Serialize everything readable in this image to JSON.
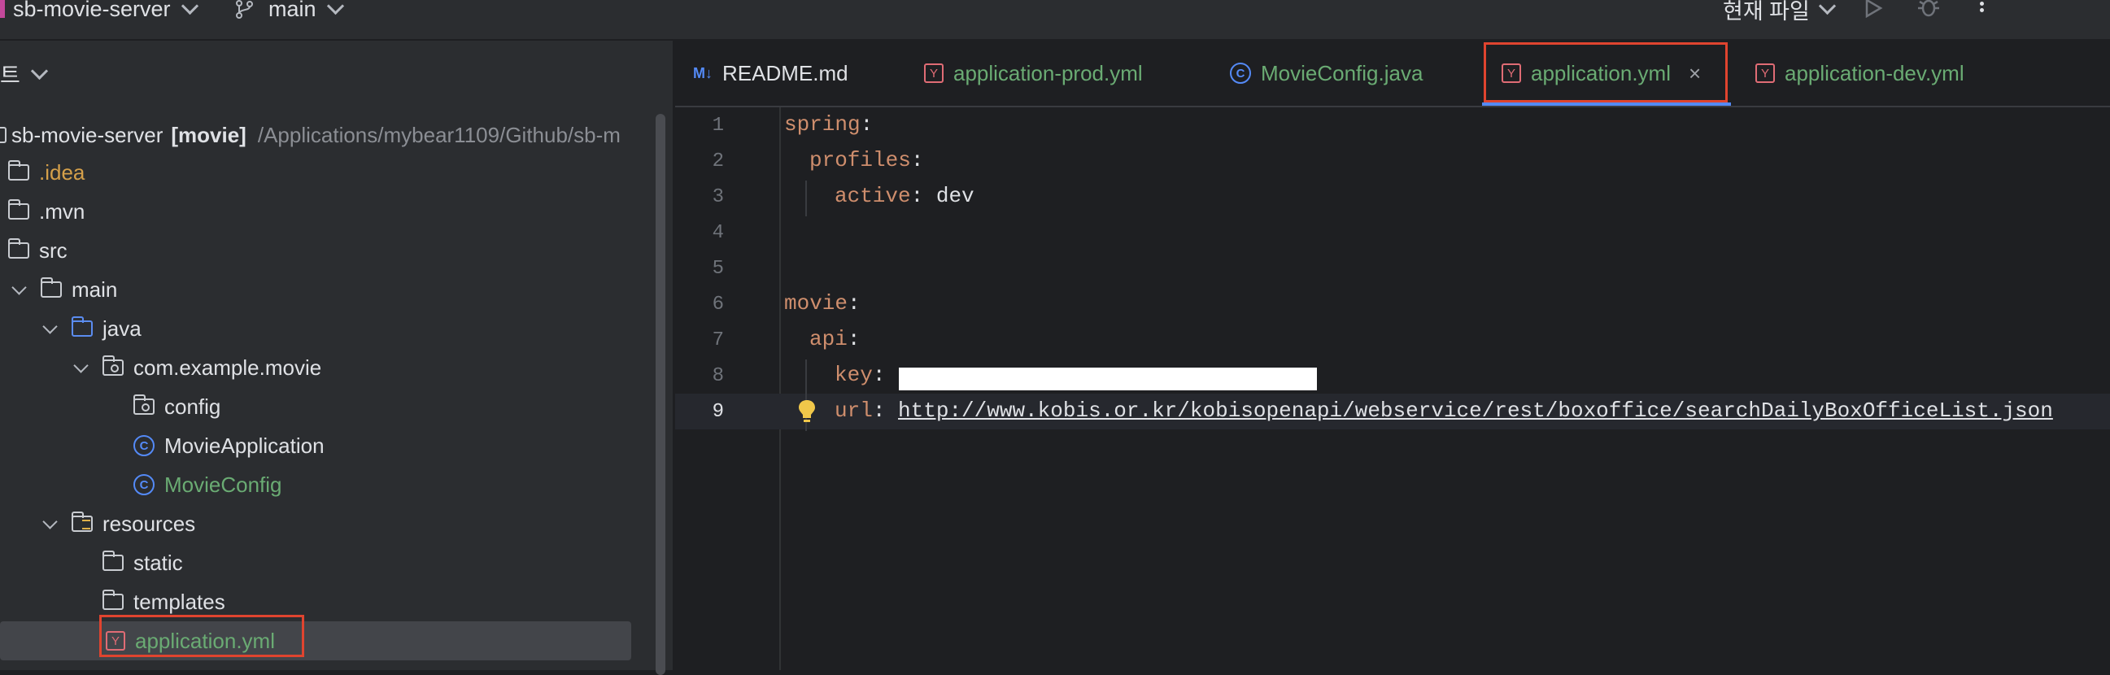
{
  "titlebar": {
    "project": "sb-movie-server",
    "branch": "main",
    "run_config": "현재 파일"
  },
  "project_panel": {
    "title": "트",
    "root": {
      "name": "sb-movie-server",
      "module": "[movie]",
      "path": "/Applications/mybear1109/Github/sb-m"
    },
    "items": [
      {
        "label": ".idea"
      },
      {
        "label": ".mvn"
      },
      {
        "label": "src"
      },
      {
        "label": "main"
      },
      {
        "label": "java"
      },
      {
        "label": "com.example.movie"
      },
      {
        "label": "config"
      },
      {
        "label": "MovieApplication"
      },
      {
        "label": "MovieConfig"
      },
      {
        "label": "resources"
      },
      {
        "label": "static"
      },
      {
        "label": "templates"
      },
      {
        "label": "application.yml"
      }
    ]
  },
  "tabs": [
    {
      "label": "README.md",
      "icon": "markdown-icon"
    },
    {
      "label": "application-prod.yml",
      "icon": "yaml-icon"
    },
    {
      "label": "MovieConfig.java",
      "icon": "class-icon"
    },
    {
      "label": "application.yml",
      "icon": "yaml-icon",
      "active": true
    },
    {
      "label": "application-dev.yml",
      "icon": "yaml-icon"
    }
  ],
  "editor": {
    "line_numbers": [
      "1",
      "2",
      "3",
      "4",
      "5",
      "6",
      "7",
      "8",
      "9"
    ],
    "lines": {
      "l1_key": "spring",
      "l2_key": "profiles",
      "l3_key": "active",
      "l3_val": "dev",
      "l6_key": "movie",
      "l7_key": "api",
      "l8_key": "key",
      "l9_key": "url",
      "l9_val": "http://www.kobis.or.kr/kobisopenapi/webservice/rest/boxoffice/searchDailyBoxOfficeList.json",
      "colon": ":"
    }
  },
  "colors": {
    "highlight_border": "#e0442f",
    "modified_file": "#6aab73",
    "ignored_file": "#d5a04a",
    "yaml_key": "#cf8e6d"
  }
}
